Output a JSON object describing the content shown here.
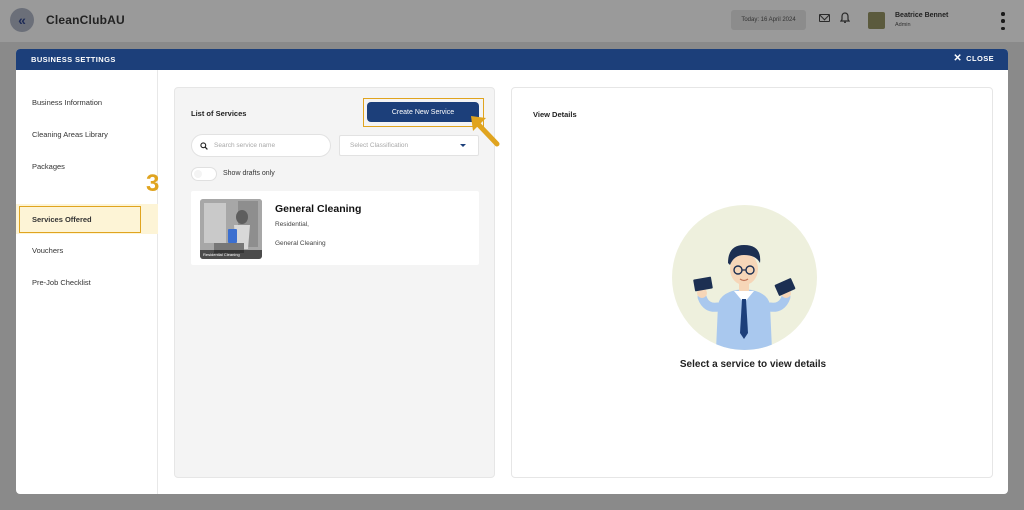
{
  "app": {
    "title": "CleanClubAU",
    "back_icon": "double-chevron-left-icon",
    "date_label": "Today: 16 April 2024",
    "user": {
      "name": "Beatrice Bennet",
      "role": "Admin"
    }
  },
  "modal": {
    "title": "BUSINESS SETTINGS",
    "close_label": "CLOSE",
    "header_color": "#1c3f7a"
  },
  "sidebar": {
    "items": [
      {
        "label": "Business Information"
      },
      {
        "label": "Cleaning Areas Library"
      },
      {
        "label": "Packages"
      },
      {
        "label": "Services Offered",
        "active": true
      },
      {
        "label": "Vouchers"
      },
      {
        "label": "Pre-Job Checklist"
      }
    ]
  },
  "annotation": {
    "step": "3",
    "color": "#e0a41f"
  },
  "services": {
    "title": "List of Services",
    "create_label": "Create New Service",
    "search_placeholder": "Search service name",
    "classification_placeholder": "Select Classification",
    "drafts_label": "Show drafts only",
    "cards": [
      {
        "name": "General Cleaning",
        "category": "Residential,",
        "subtitle": "General Cleaning",
        "thumb_tag": "Residential Cleaning"
      }
    ]
  },
  "details": {
    "title": "View Details",
    "empty_message": "Select a service to view details"
  }
}
